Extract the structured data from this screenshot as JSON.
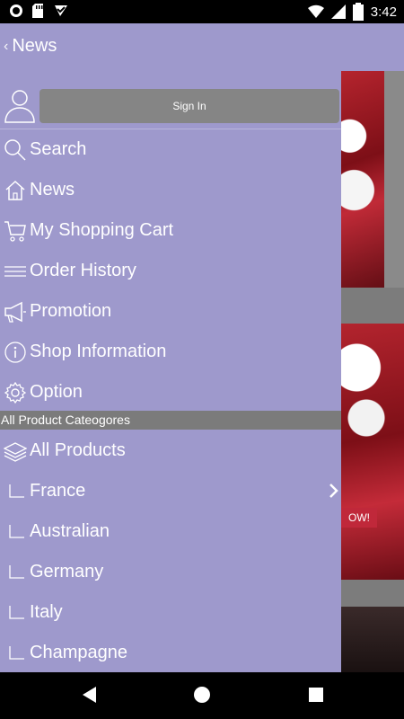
{
  "status_bar": {
    "time": "3:42",
    "battery_level": "5",
    "icons": [
      "circle-notification-icon",
      "sd-card-icon",
      "check-box-icon",
      "wifi-icon",
      "signal-icon",
      "battery-icon"
    ]
  },
  "app_bar": {
    "back_label": "News"
  },
  "drawer": {
    "signin_label": "Sign In",
    "menu": [
      {
        "label": "Search",
        "icon": "search-icon"
      },
      {
        "label": "News",
        "icon": "home-icon"
      },
      {
        "label": "My Shopping Cart",
        "icon": "cart-icon"
      },
      {
        "label": "Order History",
        "icon": "list-icon"
      },
      {
        "label": "Promotion",
        "icon": "megaphone-icon"
      },
      {
        "label": "Shop Information",
        "icon": "info-icon"
      },
      {
        "label": "Option",
        "icon": "gear-icon"
      }
    ],
    "section_header": "All Product Cateogores",
    "categories": [
      {
        "label": "All Products",
        "icon": "layers-icon"
      },
      {
        "label": "France",
        "icon": "subcategory-icon"
      },
      {
        "label": "Australian",
        "icon": "subcategory-icon"
      },
      {
        "label": "Germany",
        "icon": "subcategory-icon"
      },
      {
        "label": "Italy",
        "icon": "subcategory-icon"
      },
      {
        "label": "Champagne",
        "icon": "subcategory-icon"
      }
    ]
  },
  "background": {
    "promo_tag": "OW!"
  },
  "colors": {
    "accent": "#9e99cc",
    "section": "#7b7b7b",
    "signin": "#858585"
  }
}
